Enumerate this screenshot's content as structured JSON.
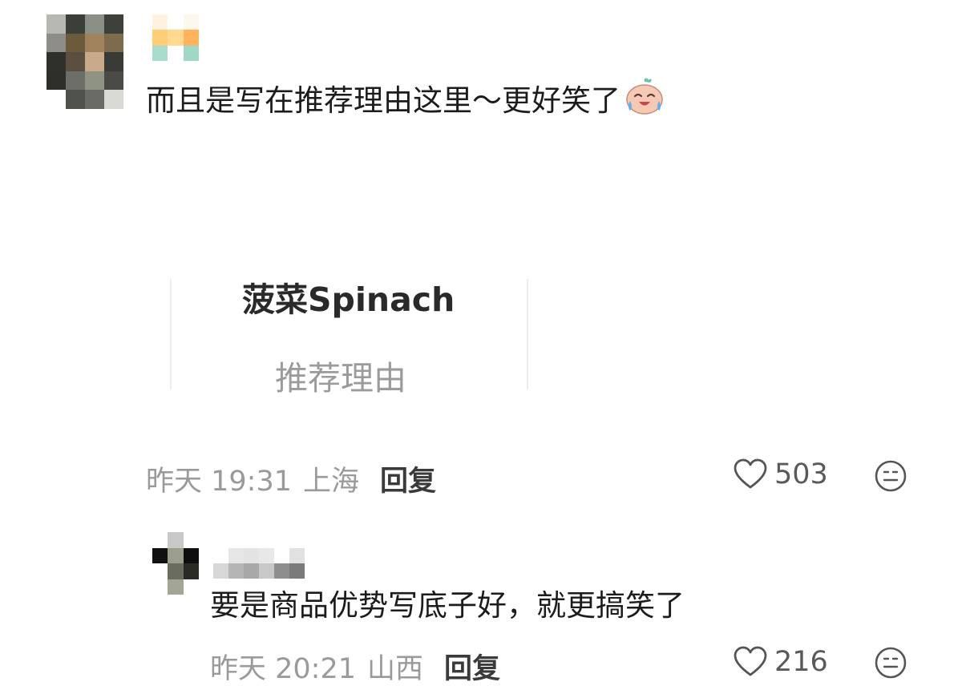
{
  "comments": [
    {
      "text": "而且是写在推荐理由这里～更好笑了",
      "emoji": "crying-laughing-face",
      "card": {
        "title": "菠菜Spinach",
        "subtitle": "推荐理由"
      },
      "time": "昨天 19:31",
      "location": "上海",
      "reply_label": "回复",
      "likes": "503"
    }
  ],
  "replies": [
    {
      "text": "要是商品优势写底子好，就更搞笑了",
      "time": "昨天 20:21",
      "location": "山西",
      "reply_label": "回复",
      "likes": "216"
    }
  ],
  "colors": {
    "avatar1": [
      "#b8b8b2",
      "#3b3f38",
      "#8a8f86",
      "#3e403b",
      "#8d8c86",
      "#6c5a3c",
      "#a0835c",
      "#7e6a4d",
      "#2f2f2c",
      "#5a4f40",
      "#c8a98a",
      "#3a3a36",
      "#2e2e2b",
      "#6e6e68",
      "#8e9384",
      "#4a4a46",
      "#ffffff",
      "#50524c",
      "#6b6b66",
      "#d9d9d6"
    ],
    "name1": [
      "#fff2e0",
      "#ffffff",
      "#fff6ec",
      "#ffcc77",
      "#ffd98f",
      "#ffb35c",
      "#a8dccd",
      "#ffffff",
      "#9fd8c4"
    ],
    "avatar2": [
      "#ffffff",
      "#c8c8c8",
      "#ffffff",
      "#111111",
      "#9b9e8c",
      "#0e0e0e",
      "#ffffff",
      "#6a6d5e",
      "#2a2b26",
      "#ffffff",
      "#a3a595",
      "#ffffff"
    ],
    "name2": [
      "#ffffff",
      "#e6e6e6",
      "#e3e3e3",
      "#e8e8e8",
      "#ffffff",
      "#e1e1e1",
      "#d7d7d7",
      "#b5b5b5",
      "#a8a8a8",
      "#c8c8c8",
      "#8e8e8e",
      "#7a7a7a"
    ]
  }
}
